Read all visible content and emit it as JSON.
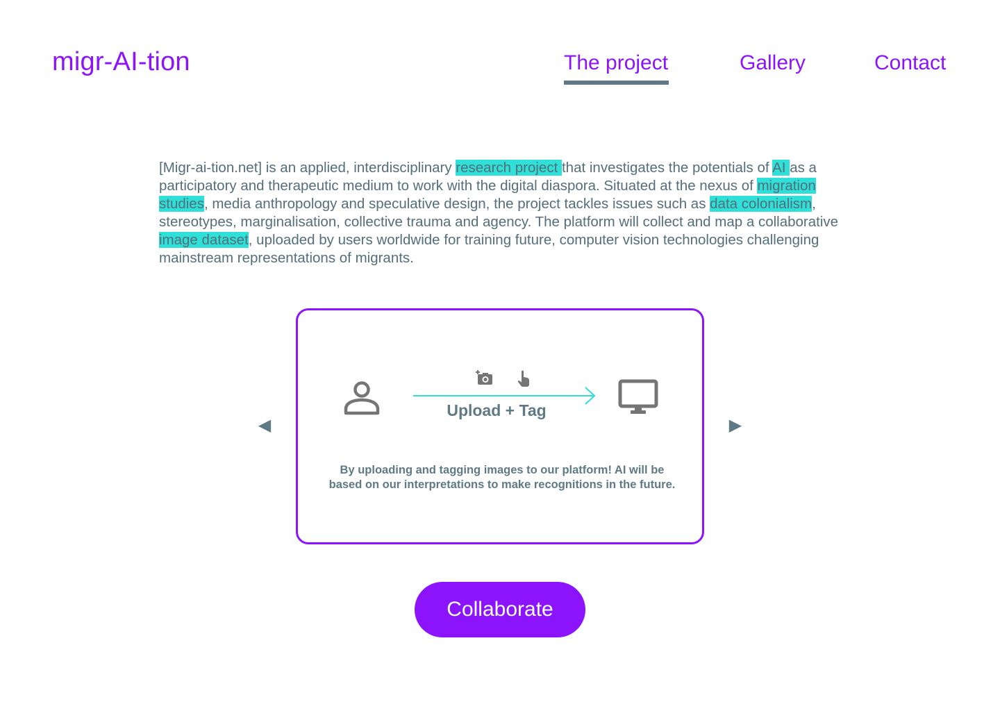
{
  "header": {
    "logo": "migr-AI-tion",
    "nav": [
      {
        "label": "The project",
        "active": true
      },
      {
        "label": "Gallery",
        "active": false
      },
      {
        "label": "Contact",
        "active": false
      }
    ]
  },
  "intro": {
    "segments": [
      {
        "text": "[Migr-ai-tion.net] is an applied, interdisciplinary ",
        "highlight": false
      },
      {
        "text": "research project ",
        "highlight": true
      },
      {
        "text": "that investigates the potentials of ",
        "highlight": false
      },
      {
        "text": "AI ",
        "highlight": true
      },
      {
        "text": "as a participatory and therapeutic medium to work with the digital diaspora. Situated at the nexus of ",
        "highlight": false
      },
      {
        "text": "migration studies",
        "highlight": true
      },
      {
        "text": ", media anthropology and speculative design, the project tackles issues such as ",
        "highlight": false
      },
      {
        "text": "data colonialism",
        "highlight": true
      },
      {
        "text": ", stereotypes, marginalisation, collective trauma and agency. The platform will collect and map a collaborative ",
        "highlight": false
      },
      {
        "text": "image dataset",
        "highlight": true
      },
      {
        "text": ", uploaded by users worldwide for training future, computer vision technologies challenging mainstream representations of migrants.",
        "highlight": false
      }
    ]
  },
  "card": {
    "step_label": "Upload + Tag",
    "description": "By uploading and tagging images to our platform! AI will be based on our interpretations to make recognitions in the future.",
    "icons": [
      "user-icon",
      "add-photo-icon",
      "touch-icon",
      "monitor-icon"
    ]
  },
  "carousel": {
    "prev_glyph": "◀",
    "next_glyph": "▶"
  },
  "cta": {
    "label": "Collaborate"
  },
  "colors": {
    "accent": "#8c14fc",
    "highlight": "#2ee0d8",
    "text": "#546e7a",
    "arrow": "#2ee0d8",
    "icon": "#757575"
  }
}
